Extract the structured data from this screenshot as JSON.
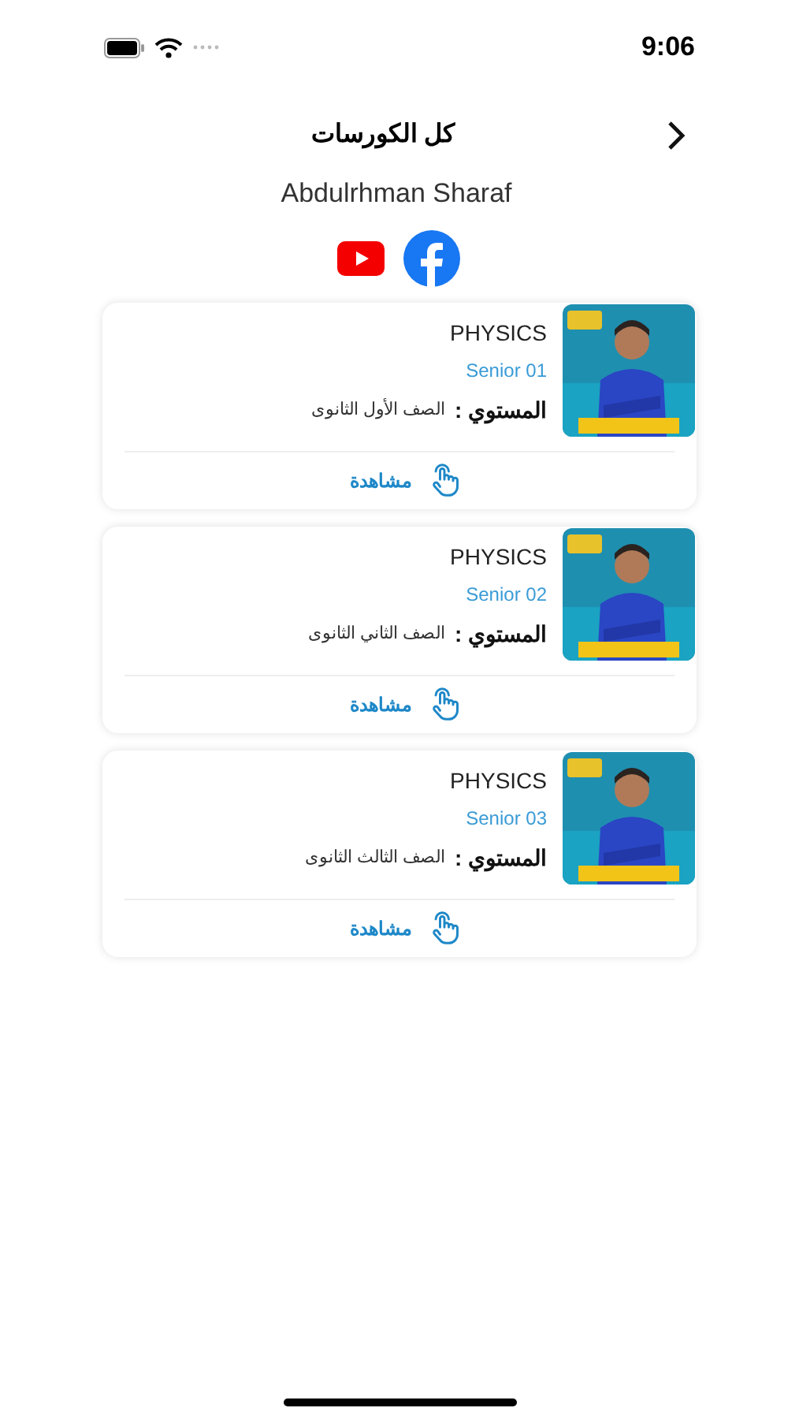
{
  "status_bar": {
    "time": "9:06"
  },
  "header": {
    "title": "كل الكورسات"
  },
  "teacher": {
    "name": "Abdulrhman Sharaf"
  },
  "courses": [
    {
      "subject": "PHYSICS",
      "code": "Senior 01",
      "level_label": "المستوي :",
      "level_value": "الصف الأول الثانوى",
      "action": "مشاهدة"
    },
    {
      "subject": "PHYSICS",
      "code": "Senior 02",
      "level_label": "المستوي :",
      "level_value": "الصف الثاني الثانوى",
      "action": "مشاهدة"
    },
    {
      "subject": "PHYSICS",
      "code": "Senior 03",
      "level_label": "المستوي :",
      "level_value": "الصف الثالث الثانوى",
      "action": "مشاهدة"
    }
  ]
}
